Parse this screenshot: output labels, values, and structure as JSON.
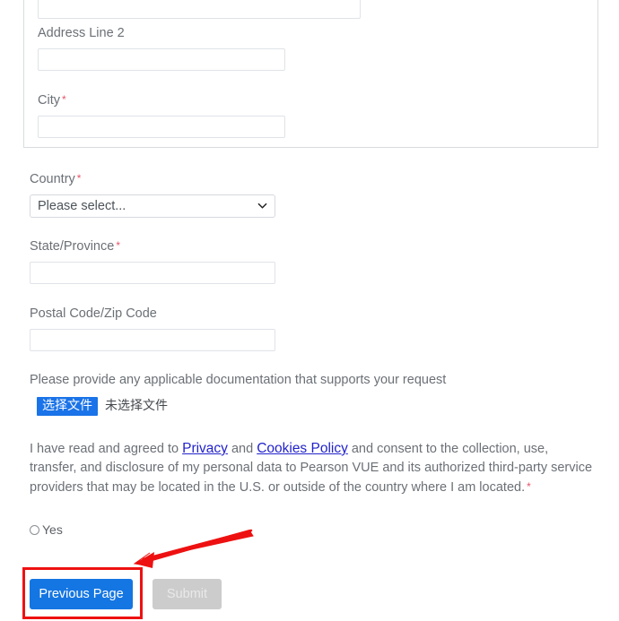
{
  "form": {
    "address_card": {
      "fields": [
        {
          "label": "",
          "required": false,
          "value": "",
          "placeholder": ""
        },
        {
          "label": "Address Line 2",
          "required": false,
          "value": "",
          "placeholder": ""
        },
        {
          "label": "City",
          "required": true,
          "value": "",
          "placeholder": ""
        }
      ]
    },
    "country": {
      "label": "Country",
      "required": true,
      "selected": "Please select...",
      "options": [
        "Please select..."
      ],
      "caret_icon": "chevron-down-icon"
    },
    "state": {
      "label": "State/Province",
      "required": true,
      "value": "",
      "placeholder": ""
    },
    "postal": {
      "label": "Postal Code/Zip Code",
      "required": false,
      "value": "",
      "placeholder": ""
    },
    "documentation": {
      "label": "Please provide any applicable documentation that supports your request",
      "file_button_label": "选择文件",
      "file_status": "未选择文件"
    },
    "consent": {
      "text_before_link1": "I have read and agreed to ",
      "link1": "Privacy",
      "text_between_links": " and ",
      "link2": "Cookies Policy",
      "text_after_links": " and consent to the collection, use, transfer, and disclosure of my personal data to Pearson VUE and its authorized third-party service providers that may be located in the U.S. or outside of the country where I am located.",
      "required_marker": "*"
    },
    "consent_radio": {
      "label": "Yes",
      "checked": false
    },
    "buttons": {
      "previous_label": "Previous Page",
      "submit_label": "Submit",
      "submit_disabled": true
    }
  },
  "required_marker": "*",
  "annotations": {
    "highlight_box_target": "Previous Page",
    "arrow_color": "#ee1111",
    "box_color": "#ee1111"
  },
  "colors": {
    "primary_blue": "#1476e2",
    "file_button_blue": "#1a73e8",
    "disabled_gray": "#cccccc",
    "label_gray": "#6b7076",
    "required_red": "#e8536a",
    "link_blue": "#2222cc",
    "annotation_red": "#ee1111"
  }
}
